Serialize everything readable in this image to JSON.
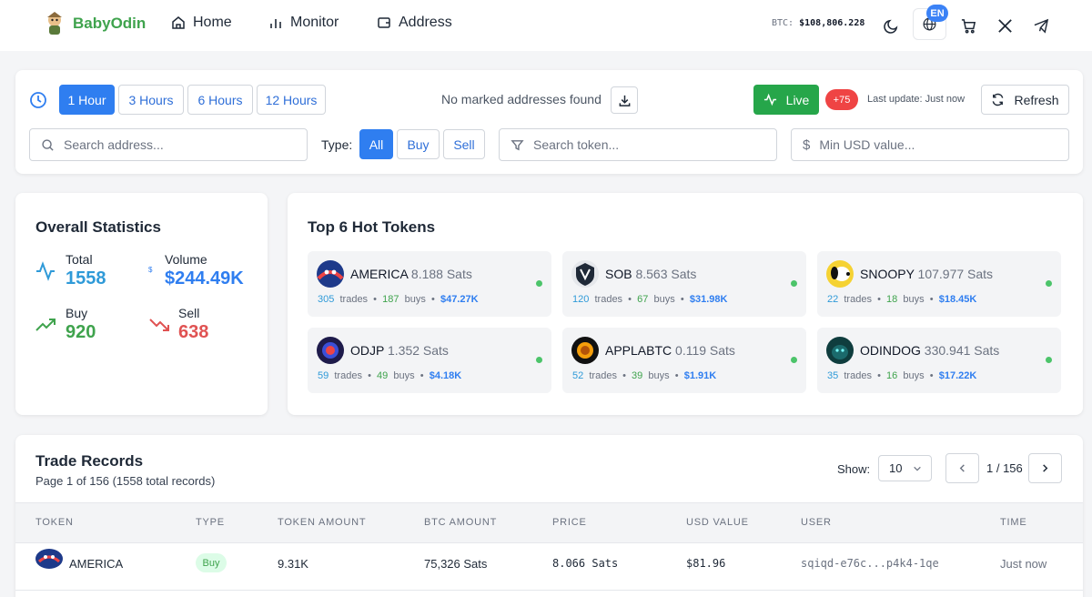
{
  "nav": {
    "brand": "BabyOdin",
    "links": [
      "Home",
      "Monitor",
      "Address"
    ],
    "btc_label": "BTC:",
    "btc_price": "$108,806.228",
    "lang": "EN"
  },
  "filter": {
    "ranges": [
      "1 Hour",
      "3 Hours",
      "6 Hours",
      "12 Hours"
    ],
    "active_range": "1 Hour",
    "no_marked": "No marked addresses found",
    "live_label": "Live",
    "new_count": "+75",
    "last_update": "Last update: Just now",
    "refresh_label": "Refresh",
    "search_address_placeholder": "Search address...",
    "type_label": "Type:",
    "types": [
      "All",
      "Buy",
      "Sell"
    ],
    "search_token_placeholder": "Search token...",
    "min_usd_placeholder": "Min USD value..."
  },
  "stats": {
    "title": "Overall Statistics",
    "total_label": "Total",
    "total_value": "1558",
    "volume_label": "Volume",
    "volume_value": "$244.49K",
    "buy_label": "Buy",
    "buy_value": "920",
    "sell_label": "Sell",
    "sell_value": "638",
    "colors": {
      "total": "#2f9ad8",
      "volume": "#2f7ef0",
      "buy": "#3fa34d",
      "sell": "#e05252"
    }
  },
  "hot": {
    "title": "Top 6 Hot Tokens",
    "tokens": [
      {
        "name": "AMERICA",
        "price": "8.188 Sats",
        "trades": "305",
        "buys": "187",
        "usd": "$47.27K",
        "icon": "america-avatar"
      },
      {
        "name": "SOB",
        "price": "8.563 Sats",
        "trades": "120",
        "buys": "67",
        "usd": "$31.98K",
        "icon": "sob-avatar"
      },
      {
        "name": "SNOOPY",
        "price": "107.977 Sats",
        "trades": "22",
        "buys": "18",
        "usd": "$18.45K",
        "icon": "snoopy-avatar"
      },
      {
        "name": "ODJP",
        "price": "1.352 Sats",
        "trades": "59",
        "buys": "49",
        "usd": "$4.18K",
        "icon": "odjp-avatar"
      },
      {
        "name": "APPLABTC",
        "price": "0.119 Sats",
        "trades": "52",
        "buys": "39",
        "usd": "$1.91K",
        "icon": "applabtc-avatar"
      },
      {
        "name": "ODINDOG",
        "price": "330.941 Sats",
        "trades": "35",
        "buys": "16",
        "usd": "$17.22K",
        "icon": "odindog-avatar"
      }
    ],
    "trades_word": "trades",
    "buys_word": "buys"
  },
  "trades": {
    "title": "Trade Records",
    "subtitle": "Page 1 of 156 (1558 total records)",
    "show_label": "Show:",
    "page_size": "10",
    "page_indicator": "1 / 156",
    "columns": [
      "TOKEN",
      "TYPE",
      "TOKEN AMOUNT",
      "BTC AMOUNT",
      "PRICE",
      "USD VALUE",
      "USER",
      "TIME"
    ],
    "rows": [
      {
        "token": "AMERICA",
        "type": "Buy",
        "token_amount": "9.31K",
        "btc_amount": "75,326 Sats",
        "price": "8.066 Sats",
        "usd_value": "$81.96",
        "user": "sqiqd-e76c...p4k4-1qe",
        "time": "Just now"
      }
    ]
  }
}
